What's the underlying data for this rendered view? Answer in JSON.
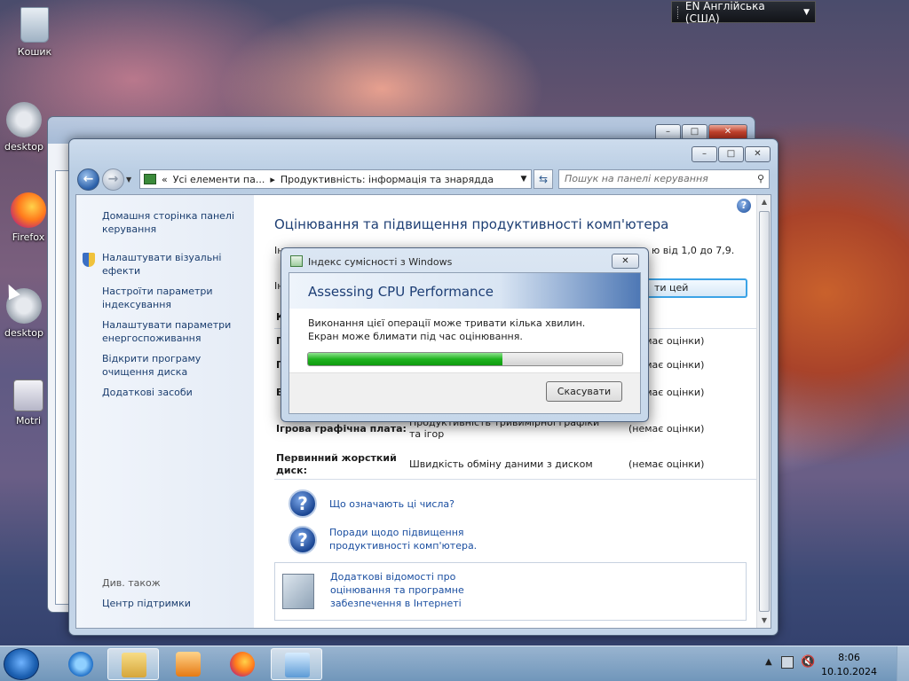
{
  "lang_bar": {
    "label": "EN Англійська (США)"
  },
  "desktop_icons": [
    {
      "label": "Кошик"
    },
    {
      "label": "desktop"
    },
    {
      "label": "Firefox"
    },
    {
      "label": "desktop"
    },
    {
      "label": "Motri"
    }
  ],
  "address": {
    "crumbs_prefix": "«",
    "crumb1": "Усі елементи па...",
    "sep": "▸",
    "crumb2": "Продуктивність: інформація та знарядда",
    "search_placeholder": "Пошук на панелі керування"
  },
  "left_pane": {
    "items": [
      "Домашня сторінка панелі керування",
      "Налаштувати візуальні ефекти",
      "Настроїти параметри індексування",
      "Налаштувати параметри енергоспоживання",
      "Відкрити програму очищення диска",
      "Додаткові засоби"
    ],
    "see_also": "Див. також",
    "support": "Центр підтримки"
  },
  "main": {
    "title": "Оцінювання та підвищення продуктивності комп'ютера",
    "partial_left_1": "Ін",
    "partial_left_2": "Ін",
    "range_text": "ю від 1,0 до 7,9.",
    "rate_button": "ти цей комп'ютер",
    "row_stub_1": "К",
    "row_stub_2": "П",
    "row_stub_3": "П",
    "row_stub_4": "В",
    "rows": [
      {
        "component": "",
        "subscore": "(немає оцінки)"
      },
      {
        "component": "",
        "subscore": "(немає оцінки)"
      },
      {
        "component": "",
        "subscore": "(немає оцінки)"
      },
      {
        "label": "Ігрова графічна плата:",
        "component": "Продуктивність тривимірної графіки та ігор",
        "subscore": "(немає оцінки)"
      },
      {
        "label": "Первинний жорсткий диск:",
        "component": "Швидкість обміну даними з диском",
        "subscore": "(немає оцінки)"
      }
    ],
    "link1": "Що означають ці числа?",
    "link2": "Поради щодо підвищення продуктивності комп'ютера.",
    "info_link": "Додаткові відомості про оцінювання та програмне забезпечення в Інтернеті"
  },
  "dialog": {
    "title": "Індекс сумісності з Windows",
    "header": "Assessing CPU Performance",
    "line1": "Виконання цієї операції може тривати кілька хвилин.",
    "line2": "Екран може блимати під час оцінювання.",
    "progress_fraction": 0.62,
    "cancel": "Скасувати"
  },
  "taskbar": {
    "time": "8:06",
    "date": "10.10.2024"
  },
  "colors": {
    "accent": "#1e3f74",
    "link": "#1a4ea0",
    "progress": "#1fb31f"
  }
}
